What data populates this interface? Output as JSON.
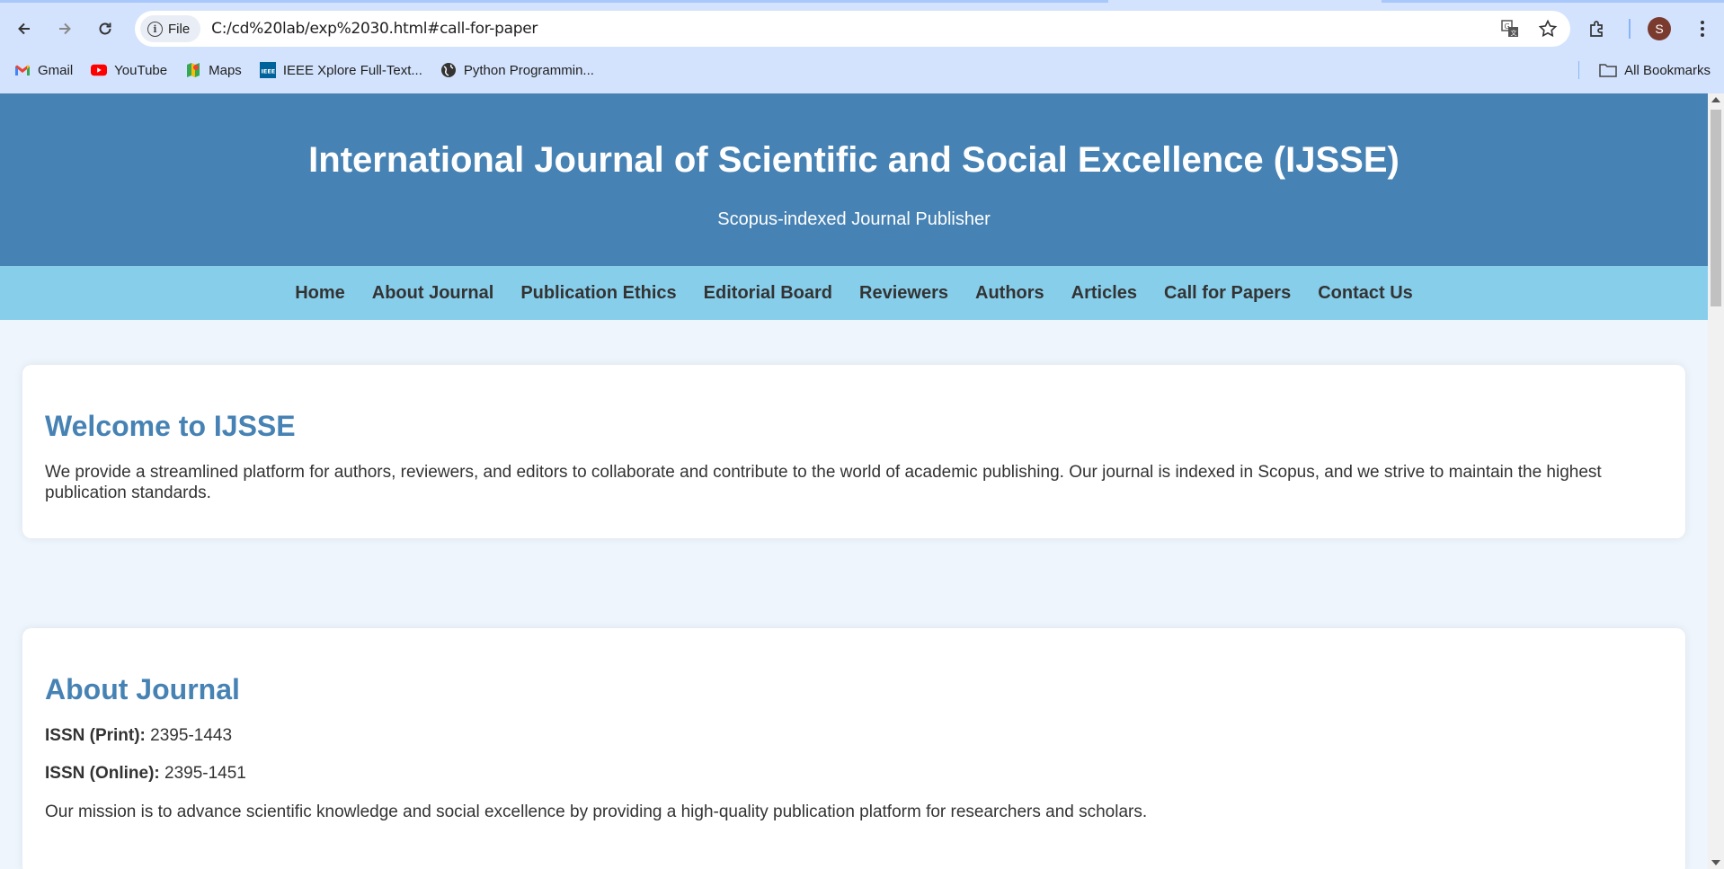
{
  "browser": {
    "url": "C:/cd%20lab/exp%2030.html#call-for-paper",
    "file_chip_label": "File",
    "avatar_letter": "S",
    "bookmarks": [
      {
        "label": "Gmail",
        "icon": "gmail-icon"
      },
      {
        "label": "YouTube",
        "icon": "youtube-icon"
      },
      {
        "label": "Maps",
        "icon": "maps-icon"
      },
      {
        "label": "IEEE Xplore Full-Text...",
        "icon": "ieee-icon"
      },
      {
        "label": "Python Programmin...",
        "icon": "globe-icon"
      }
    ],
    "all_bookmarks_label": "All Bookmarks"
  },
  "header": {
    "title": "International Journal of Scientific and Social Excellence (IJSSE)",
    "subtitle": "Scopus-indexed Journal Publisher"
  },
  "nav": {
    "items": [
      "Home",
      "About Journal",
      "Publication Ethics",
      "Editorial Board",
      "Reviewers",
      "Authors",
      "Articles",
      "Call for Papers",
      "Contact Us"
    ]
  },
  "welcome": {
    "heading": "Welcome to IJSSE",
    "body": "We provide a streamlined platform for authors, reviewers, and editors to collaborate and contribute to the world of academic publishing. Our journal is indexed in Scopus, and we strive to maintain the highest publication standards."
  },
  "about": {
    "heading": "About Journal",
    "issn_print_label": "ISSN (Print):",
    "issn_print_value": "2395-1443",
    "issn_online_label": "ISSN (Online):",
    "issn_online_value": "2395-1451",
    "mission": "Our mission is to advance scientific knowledge and social excellence by providing a high-quality publication platform for researchers and scholars."
  },
  "colors": {
    "header_bg": "#4682b4",
    "nav_bg": "#87ceeb",
    "heading": "#4682b4",
    "page_bg": "#eef5fd"
  }
}
